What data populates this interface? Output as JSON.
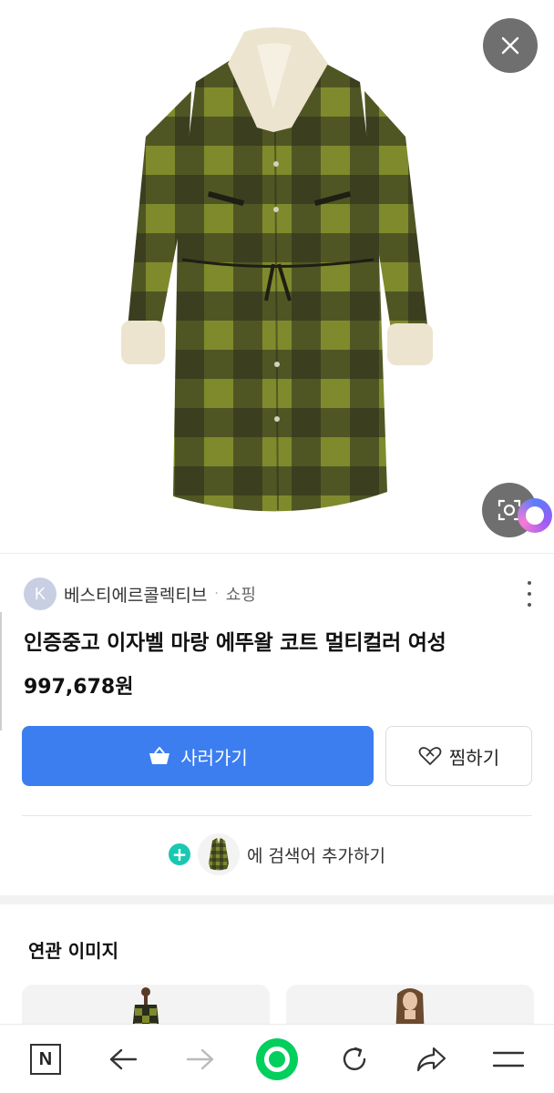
{
  "hero": {
    "image_alt": "",
    "close_icon": "close-icon",
    "lens_icon": "image-search-icon"
  },
  "seller": {
    "avatar_letter": "K",
    "name": "베스티에르콜렉티브",
    "separator": "·",
    "category": "쇼핑"
  },
  "product": {
    "title": "인증중고 이자벨 마랑 에뚜왈 코트 멀티컬러 여성",
    "price": "997,678원"
  },
  "actions": {
    "buy_label": "사러가기",
    "wish_label": "찜하기"
  },
  "add_search": {
    "plus": "+",
    "text": "에 검색어 추가하기"
  },
  "related": {
    "title": "연관 이미지"
  },
  "bottom_nav": {
    "home_letter": "N",
    "items": [
      "naver-home-icon",
      "back-arrow-icon",
      "forward-arrow-icon",
      "green-dot-icon",
      "refresh-icon",
      "share-icon",
      "menu-icon"
    ]
  },
  "colors": {
    "accent_blue": "#3c7ef0",
    "naver_green": "#03cf5d",
    "teal_plus": "#19c8b3"
  }
}
